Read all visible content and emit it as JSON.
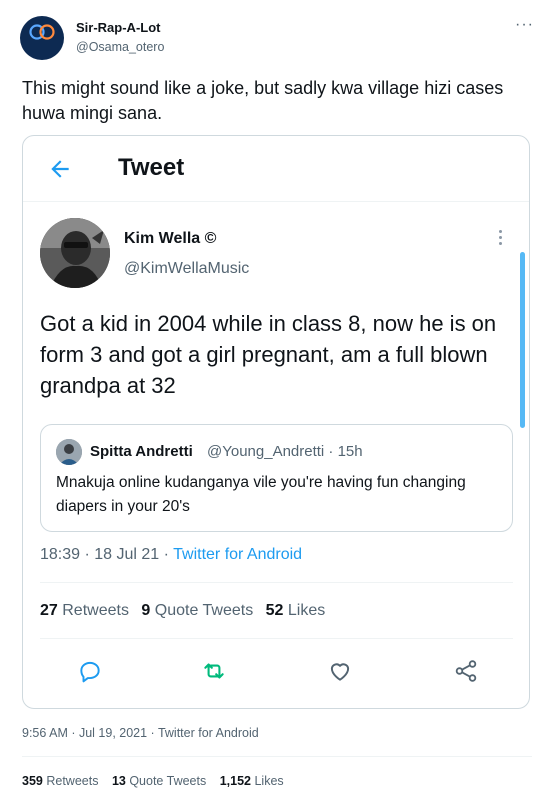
{
  "outer_tweet": {
    "name": "Sir-Rap-A-Lot",
    "handle": "@Osama_otero",
    "text": "This might sound like a joke, but sadly kwa village hizi cases huwa mingi sana.",
    "timestamp": "9:56 AM · Jul 19, 2021 · Twitter for Android",
    "retweets": "359",
    "retweets_label": "Retweets",
    "quote_tweets": "13",
    "quote_tweets_label": "Quote Tweets",
    "likes": "1,152",
    "likes_label": "Likes"
  },
  "screenshot": {
    "header_title": "Tweet",
    "author_name": "Kim Wella ©",
    "author_handle": "@KimWellaMusic",
    "text": "Got a kid in 2004 while in class 8, now he is on form 3 and got a girl pregnant, am a full blown grandpa at 32",
    "quoted": {
      "name": "Spitta Andretti",
      "handle_time": "@Young_Andretti · 15h",
      "text": "Mnakuja online kudanganya vile you're having fun changing diapers in your 20's"
    },
    "time": "18:39 · 18 Jul 21 · ",
    "source": "Twitter for Android",
    "retweets": "27",
    "retweets_label": "Retweets",
    "quote_tweets": "9",
    "quote_tweets_label": "Quote Tweets",
    "likes": "52",
    "likes_label": "Likes"
  },
  "icons": {
    "back": "arrow-left-icon",
    "reply": "reply-icon",
    "retweet": "retweet-icon",
    "like": "heart-icon",
    "share": "share-icon",
    "more": "more-icon"
  },
  "colors": {
    "accent": "#1d9bf0",
    "retweet": "#00ba7c",
    "muted": "#536471",
    "text": "#0f1419"
  }
}
